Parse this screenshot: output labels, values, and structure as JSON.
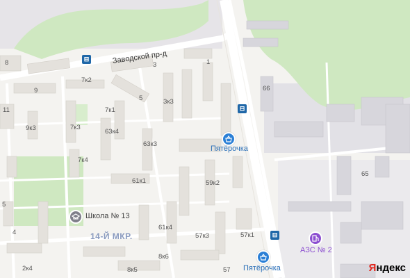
{
  "streets": {
    "zavodskoy": "Заводской пр-д"
  },
  "district": "14-Й МКР.",
  "buildings": [
    "8",
    "3",
    "1",
    "7к2",
    "9",
    "66",
    "5",
    "3к3",
    "11",
    "7к1",
    "9к3",
    "7к3",
    "63к4",
    "63к3",
    "7к4",
    "65",
    "61к1",
    "59к2",
    "5",
    "61к4",
    "4",
    "57к3",
    "57к1",
    "2к4",
    "8к5",
    "8к6",
    "57"
  ],
  "pois": {
    "shop1": "Пятёрочка",
    "shop2": "Пятёрочка",
    "school": "Школа № 13",
    "fuel": "АЗС № 2"
  },
  "icons": {
    "bus": "bus-stop-icon",
    "shop": "shopping-basket-icon",
    "school": "school-icon",
    "fuel": "fuel-icon"
  },
  "logo": {
    "first": "Я",
    "rest": "ндекс"
  },
  "colors": {
    "green": "#cfe8c1",
    "green_dark": "#b8dca7",
    "road": "#ffffff",
    "building": "#e4e1dc",
    "industrial": "#dcdbdf",
    "bus": "#1f67a8",
    "shop": "#2a7fd6",
    "fuel": "#8c4fd0"
  }
}
